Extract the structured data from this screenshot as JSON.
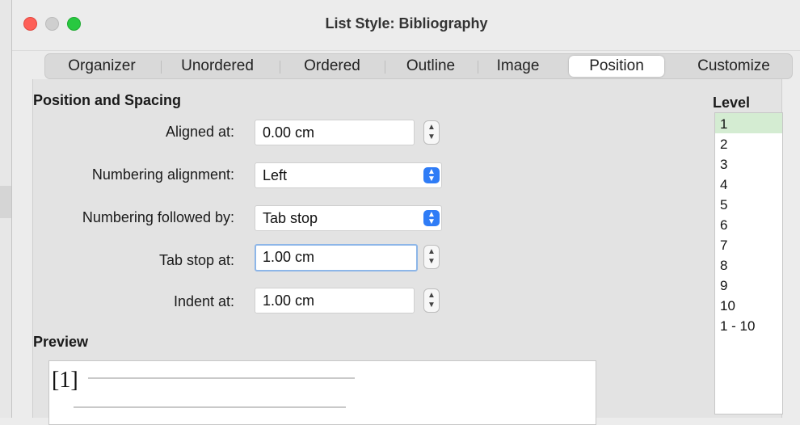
{
  "window": {
    "title": "List Style: Bibliography"
  },
  "tabs": [
    {
      "label": "Organizer"
    },
    {
      "label": "Unordered"
    },
    {
      "label": "Ordered"
    },
    {
      "label": "Outline"
    },
    {
      "label": "Image"
    },
    {
      "label": "Position",
      "active": true
    },
    {
      "label": "Customize"
    }
  ],
  "position_spacing": {
    "heading": "Position and Spacing",
    "aligned_at": {
      "label": "Aligned at:",
      "value": "0.00 cm"
    },
    "numbering_alignment": {
      "label": "Numbering alignment:",
      "value": "Left"
    },
    "numbering_followed_by": {
      "label": "Numbering followed by:",
      "value": "Tab stop"
    },
    "tab_stop_at": {
      "label": "Tab stop at:",
      "value": "1.00 cm"
    },
    "indent_at": {
      "label": "Indent at:",
      "value": "1.00 cm"
    }
  },
  "level": {
    "heading": "Level",
    "items": [
      "1",
      "2",
      "3",
      "4",
      "5",
      "6",
      "7",
      "8",
      "9",
      "10",
      "1 - 10"
    ],
    "selected": "1"
  },
  "preview": {
    "heading": "Preview",
    "sample": "[1]"
  },
  "colors": {
    "accent": "#2f7cf6",
    "selection": "#d4ecd2",
    "focus": "#8db6e8"
  }
}
